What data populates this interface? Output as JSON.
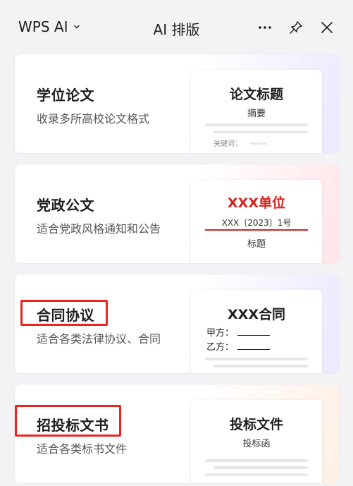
{
  "header": {
    "brand": "WPS AI",
    "title": "AI 排版"
  },
  "cards": [
    {
      "title": "学位论文",
      "desc": "收录多所高校论文格式",
      "preview": {
        "title": "论文标题",
        "subtitle": "摘要",
        "keyword": "关键词："
      }
    },
    {
      "title": "党政公文",
      "desc": "适合党政风格通知和公告",
      "preview": {
        "title": "XXX单位",
        "number": "XXX〔2023〕1号",
        "subtitle": "标题"
      }
    },
    {
      "title": "合同协议",
      "desc": "适合各类法律协议、合同",
      "preview": {
        "title": "XXX合同",
        "party_a": "甲方：",
        "party_b": "乙方："
      }
    },
    {
      "title": "招投标文书",
      "desc": "适合各类标书文件",
      "preview": {
        "title": "投标文件",
        "subtitle": "投标函"
      }
    }
  ],
  "colors": {
    "highlight": "#e8251f",
    "official_red": "#d7231e"
  }
}
